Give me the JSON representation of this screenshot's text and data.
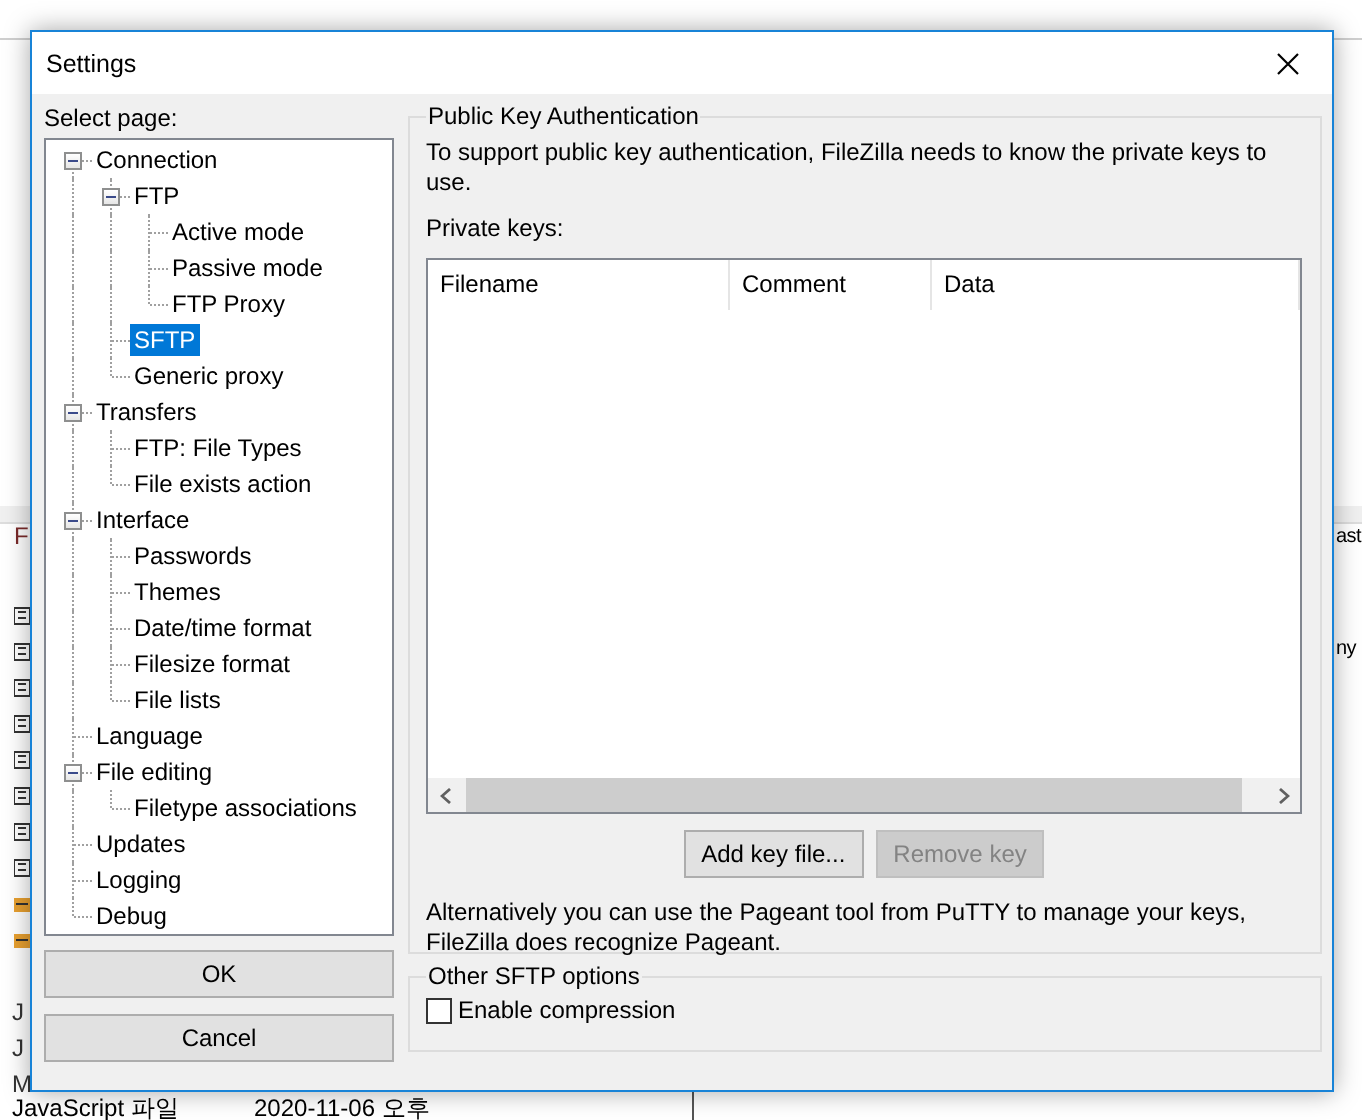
{
  "background_window": {
    "header_fragment": "F",
    "row_fragments": [
      "J",
      "J",
      "M"
    ],
    "last_row": {
      "name": "JavaScript 파일",
      "date": "2020-11-06 오후"
    },
    "right_fragments": [
      "ast",
      "ny"
    ]
  },
  "dialog": {
    "title": "Settings",
    "select_page_label": "Select page:",
    "tree": [
      {
        "label": "Connection",
        "selected": false,
        "expanded": true,
        "children": [
          {
            "label": "FTP",
            "selected": false,
            "expanded": true,
            "children": [
              {
                "label": "Active mode",
                "selected": false
              },
              {
                "label": "Passive mode",
                "selected": false
              },
              {
                "label": "FTP Proxy",
                "selected": false
              }
            ]
          },
          {
            "label": "SFTP",
            "selected": true
          },
          {
            "label": "Generic proxy",
            "selected": false
          }
        ]
      },
      {
        "label": "Transfers",
        "selected": false,
        "expanded": true,
        "children": [
          {
            "label": "FTP: File Types",
            "selected": false
          },
          {
            "label": "File exists action",
            "selected": false
          }
        ]
      },
      {
        "label": "Interface",
        "selected": false,
        "expanded": true,
        "children": [
          {
            "label": "Passwords",
            "selected": false
          },
          {
            "label": "Themes",
            "selected": false
          },
          {
            "label": "Date/time format",
            "selected": false
          },
          {
            "label": "Filesize format",
            "selected": false
          },
          {
            "label": "File lists",
            "selected": false
          }
        ]
      },
      {
        "label": "Language",
        "selected": false
      },
      {
        "label": "File editing",
        "selected": false,
        "expanded": true,
        "children": [
          {
            "label": "Filetype associations",
            "selected": false
          }
        ]
      },
      {
        "label": "Updates",
        "selected": false
      },
      {
        "label": "Logging",
        "selected": false
      },
      {
        "label": "Debug",
        "selected": false
      }
    ],
    "buttons": [
      {
        "label": "OK"
      },
      {
        "label": "Cancel"
      }
    ],
    "panel": {
      "group_title": "Public Key Authentication",
      "description": "To support public key authentication, FileZilla needs to know the private keys to use.",
      "private_keys_label": "Private keys:",
      "table": {
        "columns": [
          "Filename",
          "Comment",
          "Data"
        ]
      },
      "buttons": [
        {
          "label": "Add key file...",
          "disabled": false
        },
        {
          "label": "Remove key",
          "disabled": true
        }
      ],
      "note": "Alternatively you can use the Pageant tool from PuTTY to manage your keys, FileZilla does recognize Pageant.",
      "other_group": {
        "title": "Other SFTP options",
        "checkboxes": [
          {
            "label": "Enable compression",
            "checked": false
          }
        ]
      }
    }
  }
}
